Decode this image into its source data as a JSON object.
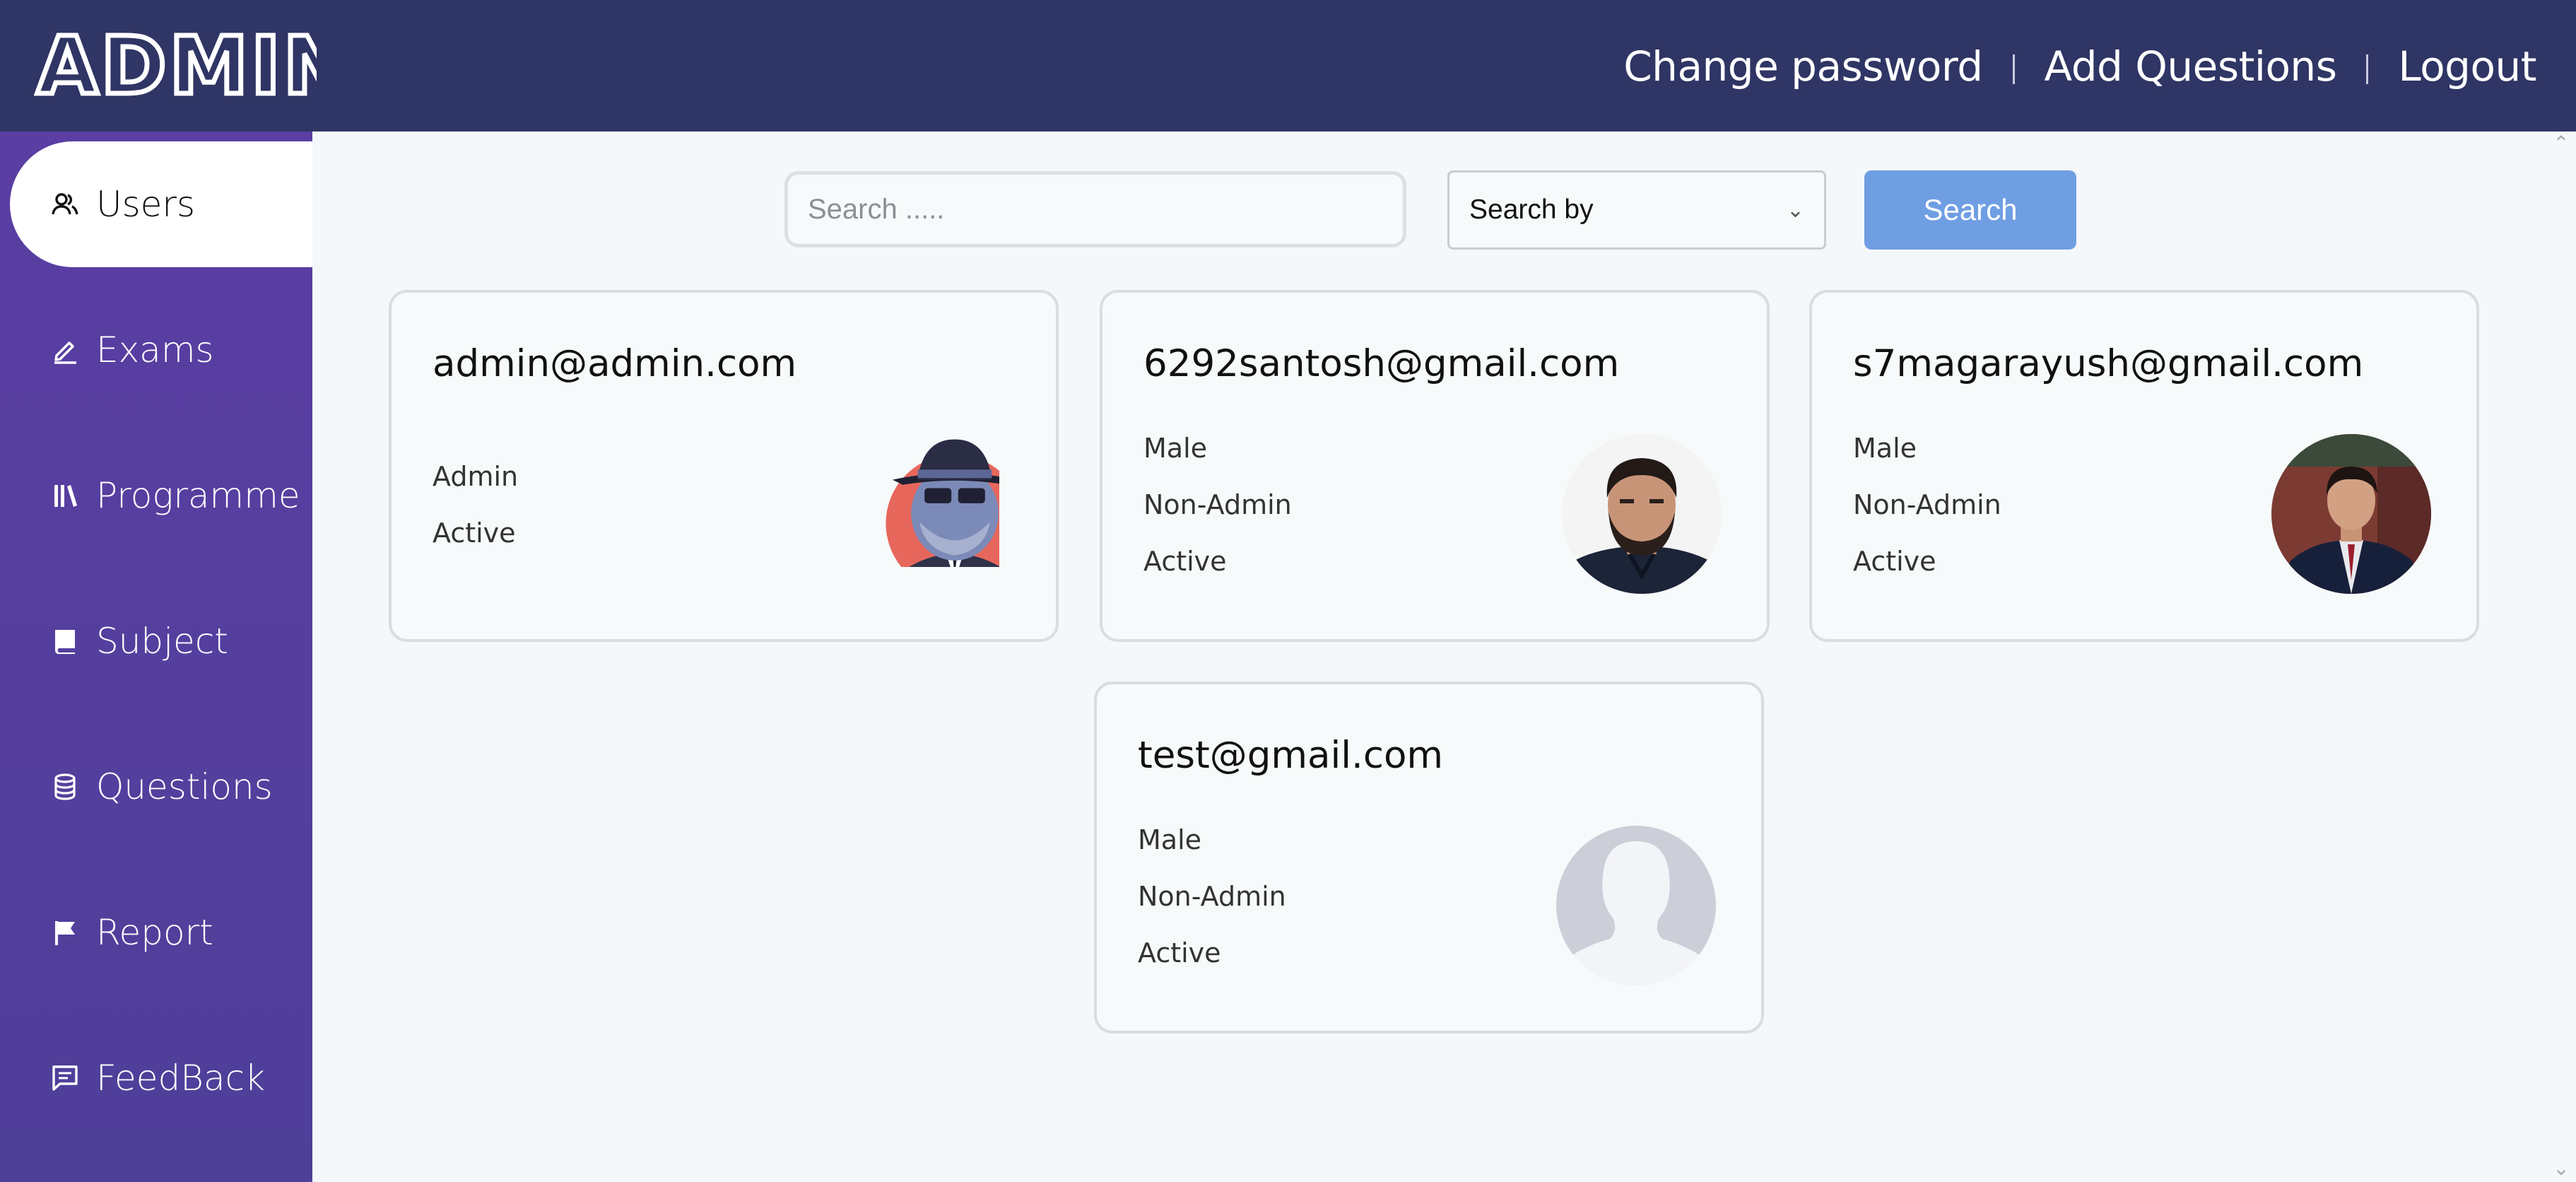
{
  "app": {
    "logo_text": "ADMIN"
  },
  "header": {
    "change_password": "Change password",
    "add_questions": "Add Questions",
    "logout": "Logout"
  },
  "sidebar": {
    "items": [
      {
        "label": "Users",
        "icon": "users-icon"
      },
      {
        "label": "Exams",
        "icon": "pencil-icon"
      },
      {
        "label": "Programme",
        "icon": "library-icon"
      },
      {
        "label": "Subject",
        "icon": "book-icon"
      },
      {
        "label": "Questions",
        "icon": "database-icon"
      },
      {
        "label": "Report",
        "icon": "flag-icon"
      },
      {
        "label": "FeedBack",
        "icon": "message-icon"
      }
    ]
  },
  "search": {
    "placeholder": "Search .....",
    "value": "",
    "search_by": "Search by",
    "button": "Search"
  },
  "users": [
    {
      "email": "admin@admin.com",
      "gender": "",
      "role": "Admin",
      "status": "Active",
      "avatar": "spy-cartoon-avatar"
    },
    {
      "email": "6292santosh@gmail.com",
      "gender": "Male",
      "role": "Non-Admin",
      "status": "Active",
      "avatar": "bearded-man-photo"
    },
    {
      "email": "s7magarayush@gmail.com",
      "gender": "Male",
      "role": "Non-Admin",
      "status": "Active",
      "avatar": "man-in-suit-photo"
    },
    {
      "email": "test@gmail.com",
      "gender": "Male",
      "role": "Non-Admin",
      "status": "Active",
      "avatar": "default-silhouette"
    }
  ],
  "colors": {
    "header_bg": "#2f3564",
    "sidebar_bg": "#553f9e",
    "search_button": "#6f9ee3",
    "page_bg": "#f5f8fa"
  }
}
